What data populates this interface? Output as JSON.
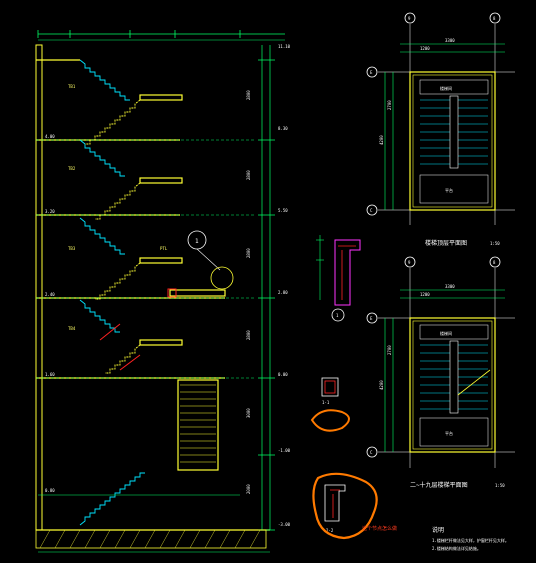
{
  "colors": {
    "background": "#000000",
    "wall": "#ffff33",
    "stair": "#00e5ff",
    "dimension": "#00ff66",
    "text": "#ffffff",
    "rebar": "#ff2222",
    "highlight": "#ff7a00",
    "magenta": "#ff33ff"
  },
  "elevation": {
    "level_labels": [
      "11.10",
      "8.30",
      "5.50",
      "2.80",
      "0.00",
      "-1.00",
      "-3.00"
    ],
    "floor_labels": [
      "4.00",
      "3.20",
      "2.40",
      "1.60",
      "0.80"
    ],
    "height_dims": [
      "2800",
      "2800",
      "2800",
      "2800",
      "3000",
      "2000"
    ],
    "detail_callout": "1",
    "flight_notes": [
      "TB1",
      "TB2",
      "TB3",
      "TB4",
      "PTL"
    ]
  },
  "plan_top": {
    "title": "楼梯顶层平面图",
    "scale": "1:50",
    "axis_labels": [
      "9",
      "8",
      "E",
      "C"
    ],
    "rooms": [
      "楼梯间",
      "平台"
    ],
    "dims": [
      "3300",
      "1200",
      "4200",
      "2700"
    ]
  },
  "plan_bottom": {
    "title": "二~十九层楼梯平面图",
    "scale": "1:50",
    "axis_labels": [
      "9",
      "8",
      "E",
      "C"
    ],
    "rooms": [
      "楼梯间",
      "平台"
    ],
    "dims": [
      "3300",
      "1200",
      "4200",
      "2700"
    ]
  },
  "section_details": {
    "detail_1": "1",
    "detail_2_label": "1-1",
    "detail_3_label": "2-2",
    "highlight_note": "这个节点怎么做"
  },
  "notes": {
    "heading": "说明",
    "line1": "1.楼梯栏杆做法见大样，护窗栏杆见大样。",
    "line2": "2.楼梯结构做法详见结施。"
  }
}
